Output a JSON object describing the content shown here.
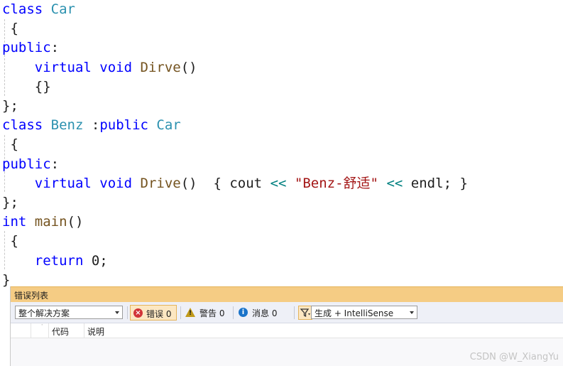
{
  "editor": {
    "lines": [
      [
        {
          "t": "class",
          "c": "kw"
        },
        {
          "t": " "
        },
        {
          "t": "Car",
          "c": "type"
        }
      ],
      [
        {
          "t": " {"
        }
      ],
      [
        {
          "t": "public",
          "c": "kw"
        },
        {
          "t": ":"
        }
      ],
      [
        {
          "t": "    "
        },
        {
          "t": "virtual",
          "c": "kw"
        },
        {
          "t": " "
        },
        {
          "t": "void",
          "c": "kw"
        },
        {
          "t": " "
        },
        {
          "t": "Dirve",
          "c": "fn"
        },
        {
          "t": "()"
        }
      ],
      [
        {
          "t": "    "
        },
        {
          "t": "{}"
        }
      ],
      [
        {
          "t": "};"
        }
      ],
      [
        {
          "t": "class",
          "c": "kw"
        },
        {
          "t": " "
        },
        {
          "t": "Benz",
          "c": "type"
        },
        {
          "t": " :"
        },
        {
          "t": "public",
          "c": "kw"
        },
        {
          "t": " "
        },
        {
          "t": "Car",
          "c": "type"
        }
      ],
      [
        {
          "t": " {"
        }
      ],
      [
        {
          "t": "public",
          "c": "kw"
        },
        {
          "t": ":"
        }
      ],
      [
        {
          "t": "    "
        },
        {
          "t": "virtual",
          "c": "kw"
        },
        {
          "t": " "
        },
        {
          "t": "void",
          "c": "kw"
        },
        {
          "t": " "
        },
        {
          "t": "Drive",
          "c": "fn"
        },
        {
          "t": "()  { "
        },
        {
          "t": "cout"
        },
        {
          "t": " "
        },
        {
          "t": "<<",
          "c": "op"
        },
        {
          "t": " "
        },
        {
          "t": "\"Benz-舒适\"",
          "c": "str"
        },
        {
          "t": " "
        },
        {
          "t": "<<",
          "c": "op"
        },
        {
          "t": " "
        },
        {
          "t": "endl"
        },
        {
          "t": "; }"
        }
      ],
      [
        {
          "t": "};"
        }
      ],
      [
        {
          "t": "int",
          "c": "kw"
        },
        {
          "t": " "
        },
        {
          "t": "main",
          "c": "fn"
        },
        {
          "t": "()"
        }
      ],
      [
        {
          "t": " {"
        }
      ],
      [
        {
          "t": "    "
        },
        {
          "t": "return",
          "c": "kw"
        },
        {
          "t": " 0;"
        }
      ],
      [
        {
          "t": "}"
        }
      ]
    ]
  },
  "error_list": {
    "title": "错误列表",
    "scope_dropdown": "整个解决方案",
    "errors_label": "错误 0",
    "warnings_label": "警告 0",
    "messages_label": "消息 0",
    "source_dropdown": "生成 + IntelliSense",
    "columns": {
      "code": "代码",
      "description": "说明"
    }
  },
  "watermark": "CSDN @W_XiangYu",
  "colors": {
    "keyword": "#0000ff",
    "type": "#2b91af",
    "function": "#74531f",
    "string": "#a31515",
    "panel_title_bg": "#f5cc84"
  },
  "icons": [
    "error-icon",
    "warning-icon",
    "info-icon",
    "filter-icon",
    "chevron-down-icon"
  ]
}
